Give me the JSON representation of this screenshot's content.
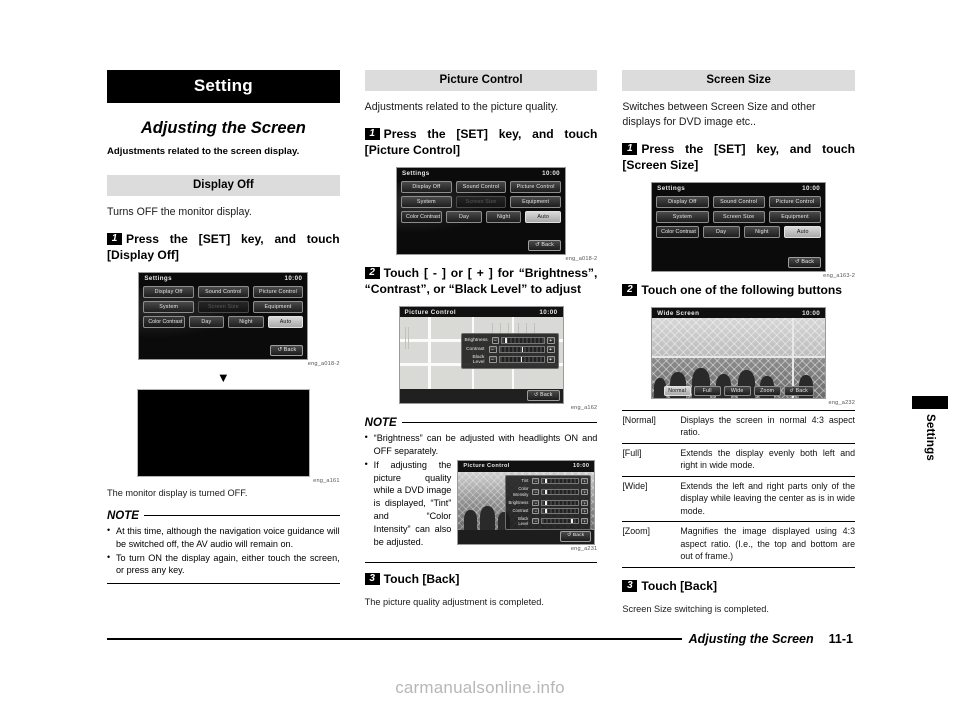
{
  "doc": {
    "chapter_title": "Setting",
    "section_title": "Adjusting the Screen",
    "section_lead": "Adjustments related to the screen display.",
    "footer_title": "Adjusting the Screen",
    "footer_page": "11-1",
    "side_tab_label": "Settings",
    "watermark": "carmanualsonline.info"
  },
  "col1": {
    "subhead": "Display Off",
    "intro": "Turns OFF the monitor display.",
    "step1": {
      "num": "1",
      "text": "Press the [SET] key, and touch [Display Off]"
    },
    "fig1_caption": "eng_a018-2",
    "fig2_caption": "eng_a161",
    "result": "The monitor display is turned OFF.",
    "note_title": "NOTE",
    "notes": [
      "At this time, although the navigation voice guidance will be switched off, the AV audio will remain on.",
      "To turn ON the display again, either touch the screen, or press any key."
    ]
  },
  "col2": {
    "subhead": "Picture Control",
    "intro": "Adjustments related to the picture quality.",
    "step1": {
      "num": "1",
      "text": "Press the [SET] key, and touch [Picture Control]"
    },
    "fig1_caption": "eng_a018-2",
    "step2": {
      "num": "2",
      "text": "Touch [ - ] or [ + ] for “Brightness”, “Contrast”, or “Black Level” to adjust"
    },
    "fig2_caption": "eng_a162",
    "note_title": "NOTE",
    "notes": [
      "“Brightness” can be adjusted with headlights ON and OFF separately.",
      "If adjusting the picture quality while a DVD image is displayed, “Tint” and “Color Intensity” can also be adjusted."
    ],
    "fig3_caption": "eng_a231",
    "step3": {
      "num": "3",
      "text": "Touch [Back]"
    },
    "result": "The picture quality adjustment is completed."
  },
  "col3": {
    "subhead": "Screen Size",
    "intro": "Switches between Screen Size and other displays for DVD image etc..",
    "step1": {
      "num": "1",
      "text": "Press the [SET] key, and touch [Screen Size]"
    },
    "fig1_caption": "eng_a163-2",
    "step2": {
      "num": "2",
      "text": "Touch one of the following buttons"
    },
    "fig2_caption": "eng_a232",
    "table": [
      {
        "key": "[Normal]",
        "value": "Displays the screen in normal 4:3 aspect ratio."
      },
      {
        "key": "[Full]",
        "value": "Extends the display evenly both left and right in wide mode."
      },
      {
        "key": "[Wide]",
        "value": "Extends the left and right parts only of the display while leaving the center as is in wide mode."
      },
      {
        "key": "[Zoom]",
        "value": "Magnifies the image displayed using 4:3 aspect ratio. (I.e., the top and bottom are out of frame.)"
      }
    ],
    "step3": {
      "num": "3",
      "text": "Touch [Back]"
    },
    "result": "Screen Size switching is completed."
  },
  "screens": {
    "settings": {
      "title": "Settings",
      "clock": "10:00",
      "row1": [
        "Display Off",
        "Sound Control",
        "Picture Control"
      ],
      "row2": [
        "System",
        "Screen Size",
        "Equipment"
      ],
      "contrast_label": "Color Contrast",
      "contrast_options": [
        "Day",
        "Night",
        "Auto"
      ],
      "contrast_selected": "Auto",
      "back": "Back"
    },
    "picture_control": {
      "title": "Picture Control",
      "clock": "10:00",
      "items": [
        "Brightness",
        "Contrast",
        "Black Level"
      ],
      "minus": "−",
      "plus": "+",
      "back": "Back"
    },
    "picture_control_dvd": {
      "title": "Picture Control",
      "clock": "10:00",
      "items": [
        "Tint",
        "Color Intensity",
        "Brightness",
        "Contrast",
        "Black Level"
      ],
      "minus": "−",
      "plus": "+",
      "back": "Back"
    },
    "wide_screen": {
      "title": "Wide Screen",
      "clock": "10:00",
      "buttons": [
        "Normal",
        "Full",
        "Wide",
        "Zoom"
      ],
      "selected": "Normal",
      "back": "Back"
    }
  }
}
